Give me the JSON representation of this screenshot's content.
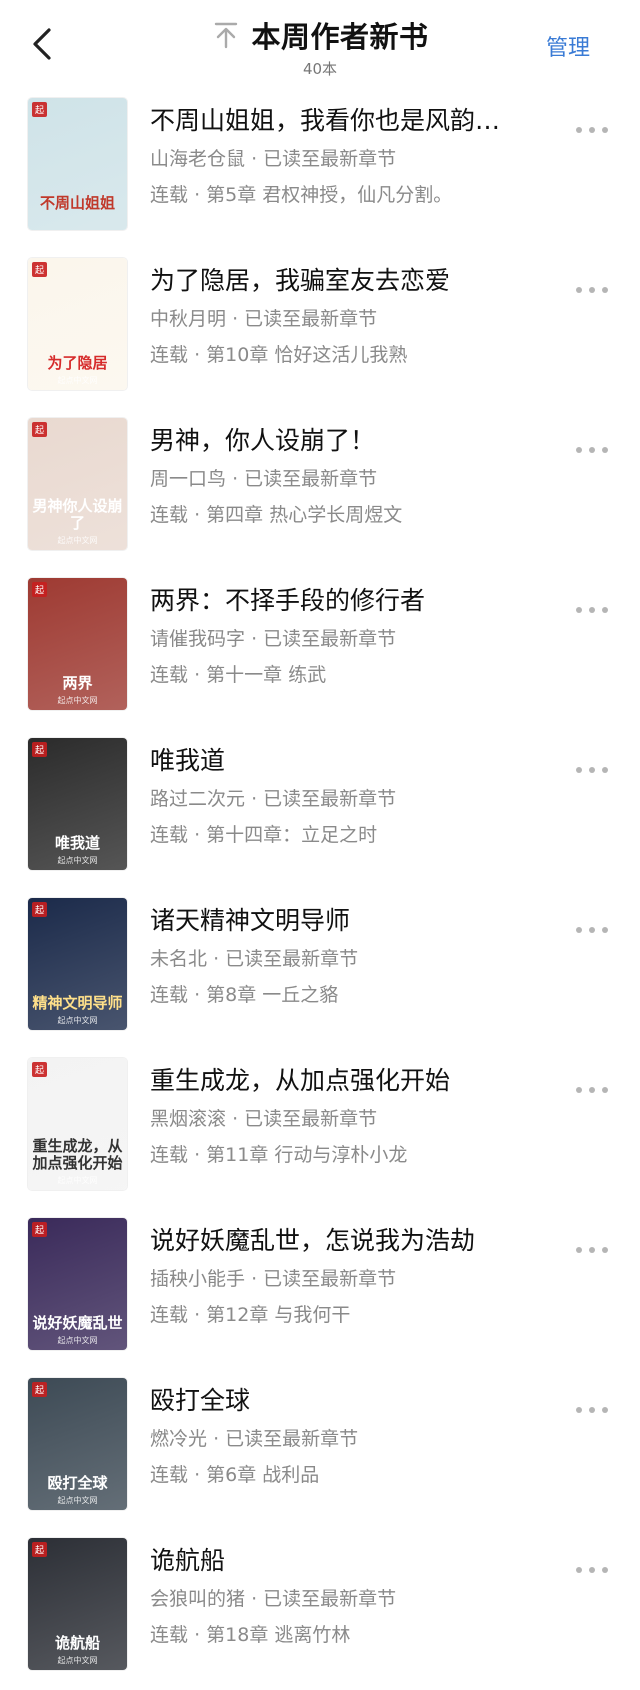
{
  "header": {
    "title": "本周作者新书",
    "count": "40本",
    "manage_label": "管理",
    "back_icon": "chevron-left-icon",
    "pin_icon": "arrow-up-to-top-icon",
    "accent_color": "#3a7bd5"
  },
  "books": [
    {
      "title": "不周山姐姐，我看你也是风韵…",
      "author": "山海老仓鼠",
      "read_status": "已读至最新章节",
      "status": "连载",
      "chapter": "第5章 君权神授，仙凡分割。",
      "cover_title": "不周山姐姐",
      "cover_pub": "",
      "cover_bg": "#cfe3e8",
      "cover_fg": "#c0392b"
    },
    {
      "title": "为了隐居，我骗室友去恋爱",
      "author": "中秋月明",
      "read_status": "已读至最新章节",
      "status": "连载",
      "chapter": "第10章 恰好这活儿我熟",
      "cover_title": "为了隐居",
      "cover_pub": "起点中文网",
      "cover_bg": "#fbf6ec",
      "cover_fg": "#d62b2b"
    },
    {
      "title": "男神，你人设崩了！",
      "author": "周一口鸟",
      "read_status": "已读至最新章节",
      "status": "连载",
      "chapter": "第四章 热心学长周煜文",
      "cover_title": "男神你人设崩了",
      "cover_pub": "起点中文网",
      "cover_bg": "#e9d9d0",
      "cover_fg": "#ffffff"
    },
    {
      "title": "两界：不择手段的修行者",
      "author": "请催我码字",
      "read_status": "已读至最新章节",
      "status": "连载",
      "chapter": "第十一章 练武",
      "cover_title": "两界",
      "cover_pub": "起点中文网",
      "cover_bg": "#9e3a32",
      "cover_fg": "#ffffff"
    },
    {
      "title": "唯我道",
      "author": "路过二次元",
      "read_status": "已读至最新章节",
      "status": "连载",
      "chapter": "第十四章：立足之时",
      "cover_title": "唯我道",
      "cover_pub": "起点中文网",
      "cover_bg": "#2b2b2b",
      "cover_fg": "#ffffff"
    },
    {
      "title": "诸天精神文明导师",
      "author": "未名北",
      "read_status": "已读至最新章节",
      "status": "连载",
      "chapter": "第8章 一丘之貉",
      "cover_title": "精神文明导师",
      "cover_pub": "起点中文网",
      "cover_bg": "#1b2a4a",
      "cover_fg": "#ffe08a"
    },
    {
      "title": "重生成龙，从加点强化开始",
      "author": "黑烟滚滚",
      "read_status": "已读至最新章节",
      "status": "连载",
      "chapter": "第11章 行动与淳朴小龙",
      "cover_title": "重生成龙，从加点强化开始",
      "cover_pub": "起点中文网",
      "cover_bg": "#f3f3f3",
      "cover_fg": "#333333"
    },
    {
      "title": "说好妖魔乱世，怎说我为浩劫",
      "author": "插秧小能手",
      "read_status": "已读至最新章节",
      "status": "连载",
      "chapter": "第12章 与我何干",
      "cover_title": "说好妖魔乱世",
      "cover_pub": "起点中文网",
      "cover_bg": "#3a2a5a",
      "cover_fg": "#ffffff"
    },
    {
      "title": "殴打全球",
      "author": "燃冷光",
      "read_status": "已读至最新章节",
      "status": "连载",
      "chapter": "第6章 战利品",
      "cover_title": "殴打全球",
      "cover_pub": "起点中文网",
      "cover_bg": "#3d4a55",
      "cover_fg": "#ffffff"
    },
    {
      "title": "诡航船",
      "author": "会狼叫的猪",
      "read_status": "已读至最新章节",
      "status": "连载",
      "chapter": "第18章 逃离竹林",
      "cover_title": "诡航船",
      "cover_pub": "起点中文网",
      "cover_bg": "#2c2f36",
      "cover_fg": "#ffffff"
    }
  ]
}
